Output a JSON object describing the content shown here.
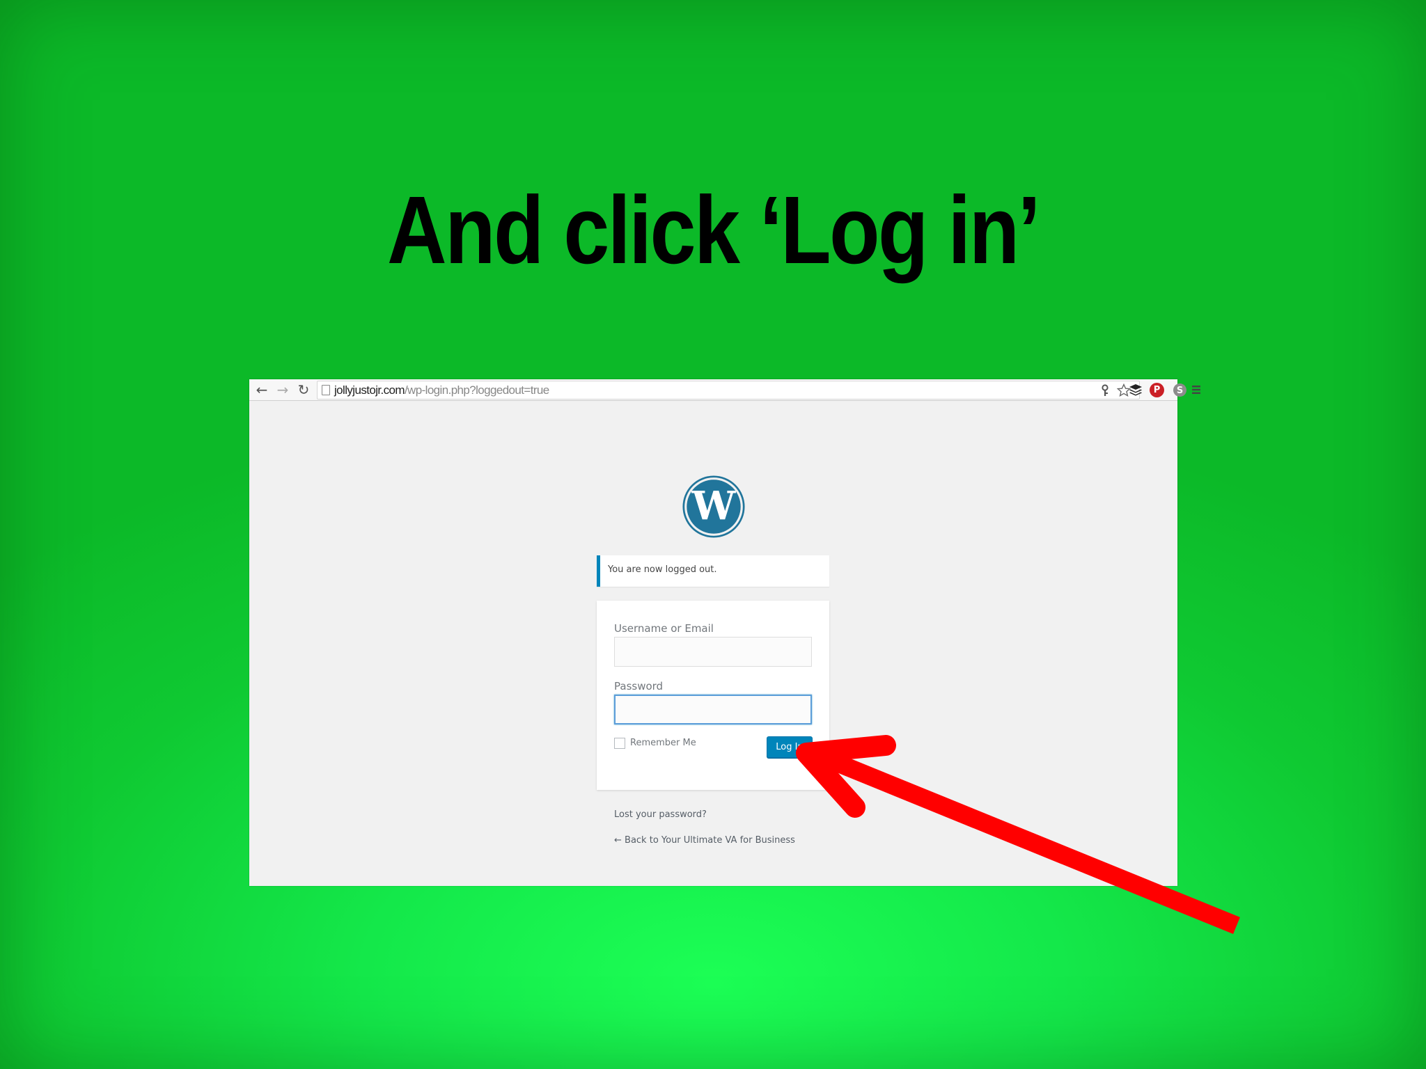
{
  "slide": {
    "title": "And click ‘Log in’"
  },
  "browser": {
    "nav": {
      "back_glyph": "←",
      "forward_glyph": "→",
      "reload_glyph": "↻"
    },
    "address": {
      "host": "jollyjustojr.com",
      "path": "/wp-login.php?loggedout=true"
    },
    "icons": [
      "key-icon",
      "star-icon",
      "buffer-icon",
      "pinterest-icon",
      "skype-icon",
      "menu-icon"
    ]
  },
  "login": {
    "notice": "You are now logged out.",
    "username_label": "Username or Email",
    "username_value": "",
    "password_label": "Password",
    "password_value": "",
    "remember_label": "Remember Me",
    "submit_label": "Log In",
    "lost_password": "Lost your password?",
    "back_link": "← Back to Your Ultimate VA for Business"
  },
  "colors": {
    "background_green": "#14e84a",
    "wp_blue": "#0085ba",
    "wp_logo": "#21759b",
    "arrow_red": "#ff0000",
    "pinterest_red": "#cb2027"
  }
}
